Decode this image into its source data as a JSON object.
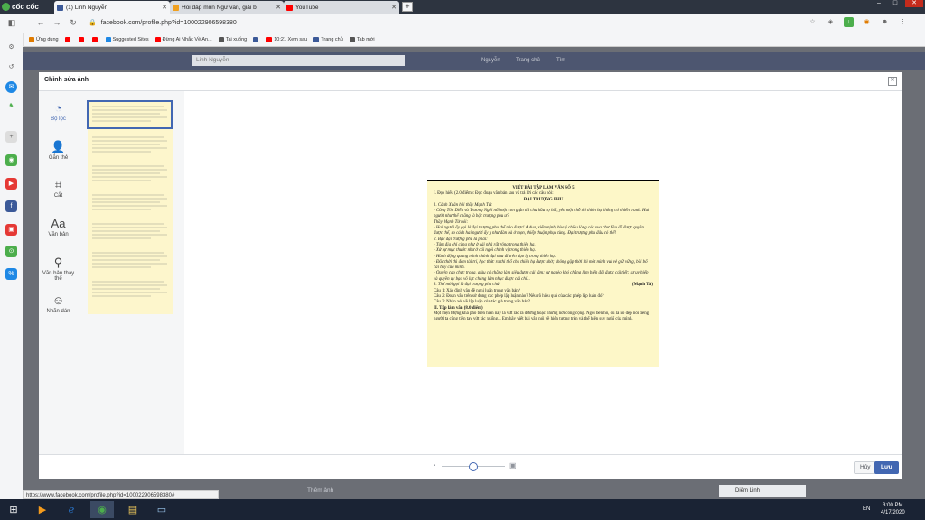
{
  "browser": {
    "brand": "cốc cốc",
    "tabs": [
      {
        "title": "(1) Linh Nguyễn",
        "color": "#3b5998"
      },
      {
        "title": "Hỏi đáp môn Ngữ văn, giải b",
        "color": "#f0a020"
      },
      {
        "title": "YouTube",
        "color": "#ff0000"
      }
    ],
    "url": "facebook.com/profile.php?id=100022906598380",
    "bookmarks": [
      {
        "label": "Ứng dụng",
        "color": "#e07b00"
      },
      {
        "label": "",
        "color": "#ff0000"
      },
      {
        "label": "",
        "color": "#ff0000"
      },
      {
        "label": "",
        "color": "#ff0000"
      },
      {
        "label": "Suggested Sites",
        "color": "#1e88e5"
      },
      {
        "label": "Đừng Ai Nhắc Về An...",
        "color": "#ff0000"
      },
      {
        "label": "Tai xuống",
        "color": "#555555"
      },
      {
        "label": "",
        "color": "#3b5998"
      },
      {
        "label": "10:21 Xem sau",
        "color": "#ff0000"
      },
      {
        "label": "Trang chủ",
        "color": "#3b5998"
      },
      {
        "label": "Tab mới",
        "color": "#555555"
      }
    ]
  },
  "facebook": {
    "search_value": "Linh Nguyễn",
    "nav": [
      "Nguyễn",
      "Trang chủ",
      "Tìm"
    ],
    "behind_left": "Thêm ảnh",
    "chat_name": "Diễm Linh"
  },
  "modal": {
    "title": "Chỉnh sửa ảnh",
    "tools": [
      {
        "label": "Bộ lọc",
        "glyph": "◔"
      },
      {
        "label": "Gắn thẻ",
        "glyph": "👤"
      },
      {
        "label": "Cắt",
        "glyph": "⌗"
      },
      {
        "label": "Văn bản",
        "glyph": "Aa"
      },
      {
        "label": "Văn bản thay thế",
        "glyph": "⚲"
      },
      {
        "label": "Nhãn dán",
        "glyph": "☺"
      }
    ],
    "cancel_label": "Hủy",
    "save_label": "Lưu"
  },
  "document": {
    "title": "VIẾT BÀI TẬP LÀM VĂN SỐ 5",
    "part1": "I. Đọc hiểu (2.0 điểm): Đọc đoạn văn bản sau và trả lời các câu hỏi:",
    "subtitle": "ĐẠI TRƯỢNG PHU",
    "lines": [
      "1. Cảnh Xuân hỏi thầy Mạnh Tử:",
      "- Công Tôn Diễn và Trương Nghi nổi một cơn giận thì chư hầu sợ hãi, yên một chỗ thì thiên hạ không có chiến tranh. Hai người như thế chẳng là bậc trượng phu ư?",
      "Thầy Mạnh Tử nói:",
      "- Hai người ấy gọi là đại trượng phu thế nào được! A dua, xiểm nịnh, hùa ý chiều lòng các vua chư hầu để được quyền được thế, so cách hai người ấy y như đàn bà ở mọn, thiếp thuận phục tùng. Đại trượng phu đâu có thế!",
      "2. Bậc đại trượng phu là phải:",
      "- Tâm địa chỉ cùng như ở cái nhà rất rộng trong thiên hạ.",
      "- Xử sự mực thước như ở cái ngôi chính vị trong thiên hạ.",
      "- Hành động quang minh chính đại như đi trên đạo lý trong thiên hạ.",
      "- Đắc thời thì đem tài trí, học thức ra thi thố cho thiên hạ được nhờ; không gặp thời thì một mình vui vẻ giữ vững, bồi bổ cái hay của mình.",
      "- Quyền cao chức trọng, giàu có chẳng làm siêu được cái tâm; sự nghèo khó chẳng làm biến đổi được cái tiết; sự uy hiếp và quyền uy bạo võ lực chẳng làm nhục được cái chí...",
      "3. Thế mới gọi là đại trượng phu chứ!"
    ],
    "source": "(Mạnh Tử)",
    "questions": [
      "Câu 1: Xác định văn đề nghị luận trong văn bản?",
      "Câu 2: Đoạn văn trên sử dụng các phép lập luận nào? Nêu rõ hiệu quả của các phép lập luận đó?",
      "Câu 3: Nhận xét về lập luận của tác giả trong văn bản?"
    ],
    "part2": "II. Tập làm văn (8.0 điểm)",
    "essay": "Một hiện tượng khá phổ biến hiện nay là vứt rác ra đường hoặc những nơi công cộng. Ngồi bên hồ, dù là hồ đẹp nổi tiếng, người ta cũng tiện tay vứt rác xuống... Em hãy viết bài văn nói về hiện tượng trên và thể hiện suy nghĩ của mình."
  },
  "status_url": "https://www.facebook.com/profile.php?id=100022906598380#",
  "taskbar": {
    "lang": "EN",
    "time": "3:00 PM",
    "date": "4/17/2020"
  },
  "colors": {
    "fb_blue": "#4267b2",
    "doc_bg": "#fdf7c8",
    "taskbar": "#1a2334"
  }
}
